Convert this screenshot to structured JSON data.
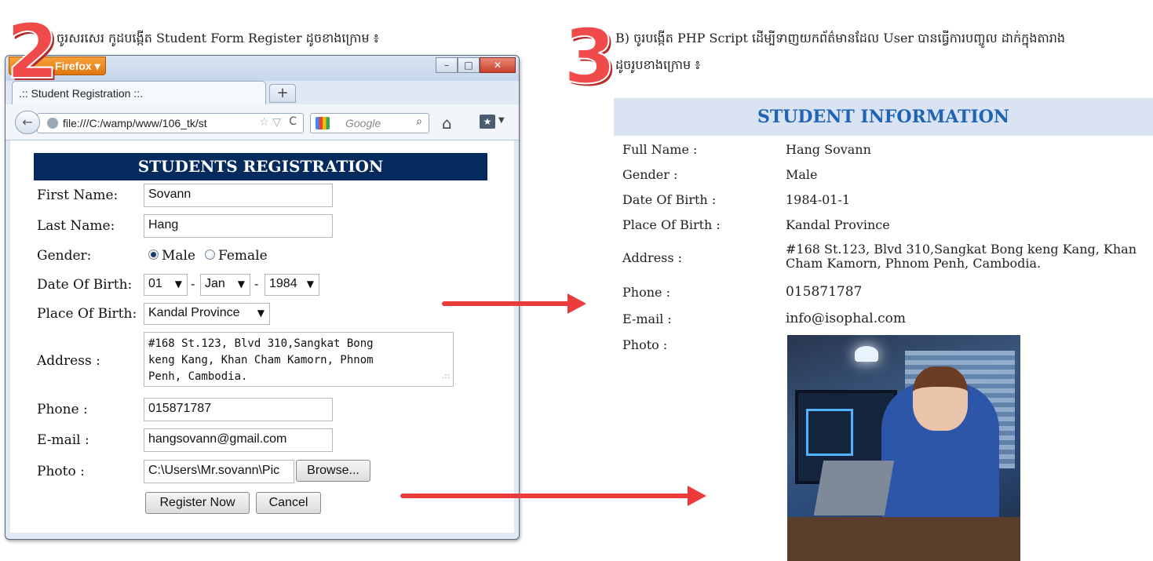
{
  "step2": {
    "number": "2",
    "caption": "ចូរសរសេរ កូដបង្កើត Student Form Register ដូចខាងក្រោម ៖"
  },
  "step3": {
    "number": "3",
    "caption_line1": "B) ចូរបង្កើត PHP Script ដើម្បីទាញយកព័ត៌មានដែល User បានធ្វើការបញ្ចូល ដាក់ក្នុងតារាង",
    "caption_line2": "ដូចរូបខាងក្រោម ៖"
  },
  "browser": {
    "app_button": "Firefox",
    "tab_title": ".:: Student Registration ::.",
    "new_tab": "+",
    "url": "file:///C:/wamp/www/106_tk/st",
    "search_placeholder": "Google"
  },
  "form": {
    "header": "STUDENTS REGISTRATION",
    "first_name_label": "First Name:",
    "first_name_value": "Sovann",
    "last_name_label": "Last Name:",
    "last_name_value": "Hang",
    "gender_label": "Gender:",
    "gender_male": "Male",
    "gender_female": "Female",
    "gender_selected": "Male",
    "dob_label": "Date Of Birth:",
    "dob_day": "01",
    "dob_month": "Jan",
    "dob_year": "1984",
    "dob_separator": "-",
    "pob_label": "Place Of Birth:",
    "pob_value": "Kandal Province",
    "address_label": "Address :",
    "address_line1": "#168 St.123, Blvd 310,Sangkat Bong",
    "address_line2": "keng Kang, Khan Cham Kamorn, Phnom",
    "address_line3": "Penh, Cambodia.",
    "phone_label": "Phone :",
    "phone_value": "015871787",
    "email_label": "E-mail :",
    "email_value": "hangsovann@gmail.com",
    "photo_label": "Photo :",
    "photo_value": "C:\\Users\\Mr.sovann\\Pic",
    "browse_button": "Browse...",
    "register_button": "Register Now",
    "cancel_button": "Cancel"
  },
  "info": {
    "header": "STUDENT INFORMATION",
    "full_name_label": "Full Name :",
    "full_name_value": "Hang Sovann",
    "gender_label": "Gender :",
    "gender_value": "Male",
    "dob_label": "Date Of Birth :",
    "dob_value": "1984-01-1",
    "pob_label": "Place Of Birth :",
    "pob_value": "Kandal Province",
    "address_label": "Address :",
    "address_line1": "#168 St.123, Blvd 310,Sangkat Bong keng Kang, Khan",
    "address_line2": "Cham Kamorn, Phnom Penh, Cambodia.",
    "phone_label": "Phone :",
    "phone_value": "015871787",
    "email_label": "E-mail :",
    "email_value": "info@isophal.com",
    "photo_label": "Photo :"
  },
  "colors": {
    "accent_red": "#ec3b3b",
    "form_header_bg": "#052a5e",
    "info_header_bg": "#d9e3f1",
    "info_header_text": "#2064b4"
  }
}
